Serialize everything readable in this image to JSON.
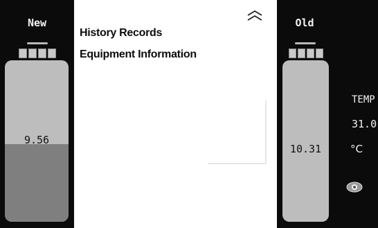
{
  "panels": {
    "new": {
      "title": "New",
      "value": "9.56",
      "fill_fraction": 0.48
    },
    "old": {
      "title": "Old",
      "value": "10.31",
      "fill_fraction": 0.0
    }
  },
  "menu": {
    "items": [
      {
        "label": "History Records"
      },
      {
        "label": "Equipment Information"
      }
    ]
  },
  "temperature": {
    "label": "TEMP",
    "value": "31.0",
    "unit": "°C"
  },
  "colors": {
    "panel_bg": "#0b0b0b",
    "battery_light": "#bdbdbd",
    "battery_dark": "#7f7f7f",
    "page_bg": "#ffffff"
  },
  "icons": {
    "collapse": "chevron-up-double-icon",
    "view": "eye-icon"
  }
}
